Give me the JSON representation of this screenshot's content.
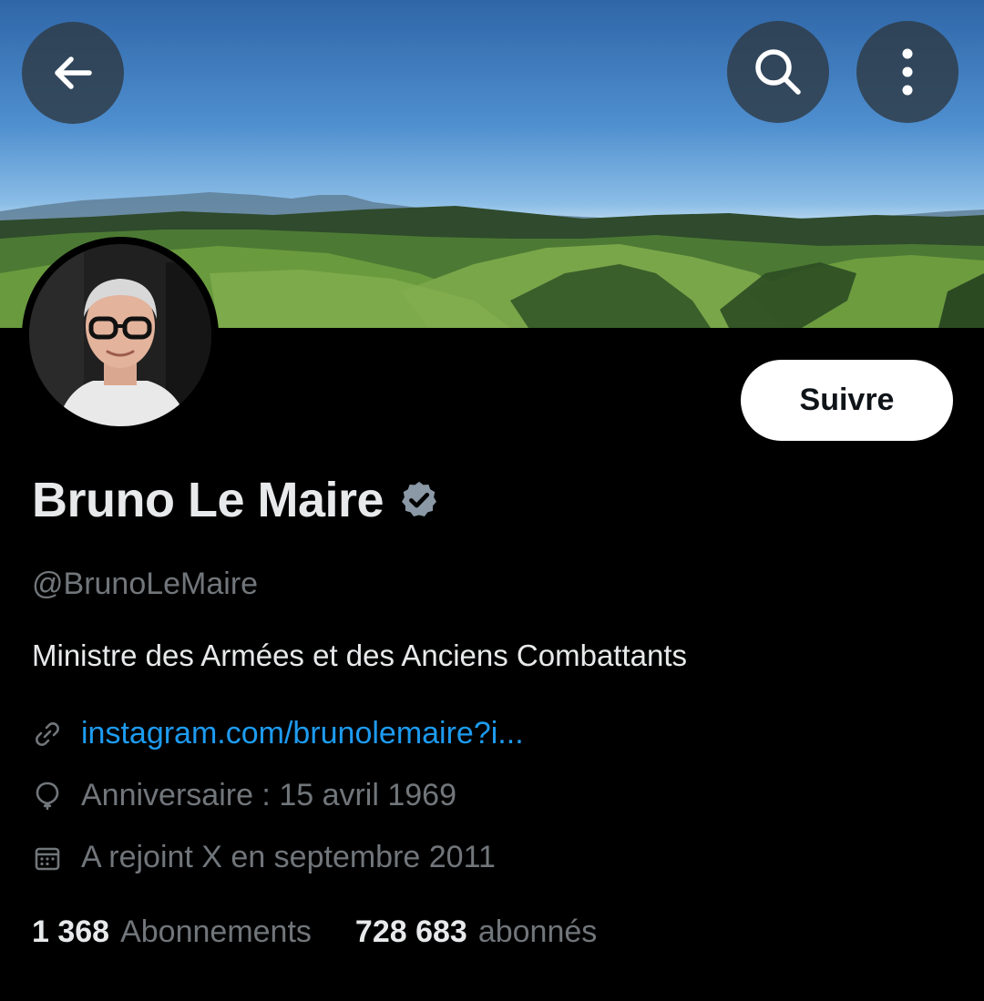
{
  "header": {
    "back_icon": "arrow-left-icon",
    "search_icon": "search-icon",
    "more_icon": "more-vertical-icon"
  },
  "profile": {
    "name": "Bruno Le Maire",
    "verified_icon": "verified-badge-icon",
    "verified_color": "#8b98a5",
    "handle": "@BrunoLeMaire",
    "bio": "Ministre des Armées et des Anciens Combattants",
    "follow_label": "Suivre"
  },
  "meta": {
    "link_icon": "link-icon",
    "link": "instagram.com/brunolemaire?i...",
    "birthday_icon": "balloon-icon",
    "birthday": "Anniversaire : 15 avril 1969",
    "joined_icon": "calendar-icon",
    "joined": "A rejoint X en septembre 2011"
  },
  "stats": {
    "following_count": "1 368",
    "following_label": "Abonnements",
    "followers_count": "728 683",
    "followers_label": "abonnés"
  },
  "colors": {
    "background": "#000000",
    "primary_text": "#e7e9ea",
    "secondary_text": "#71767b",
    "link": "#1d9bf0",
    "button_bg": "#ffffff"
  }
}
